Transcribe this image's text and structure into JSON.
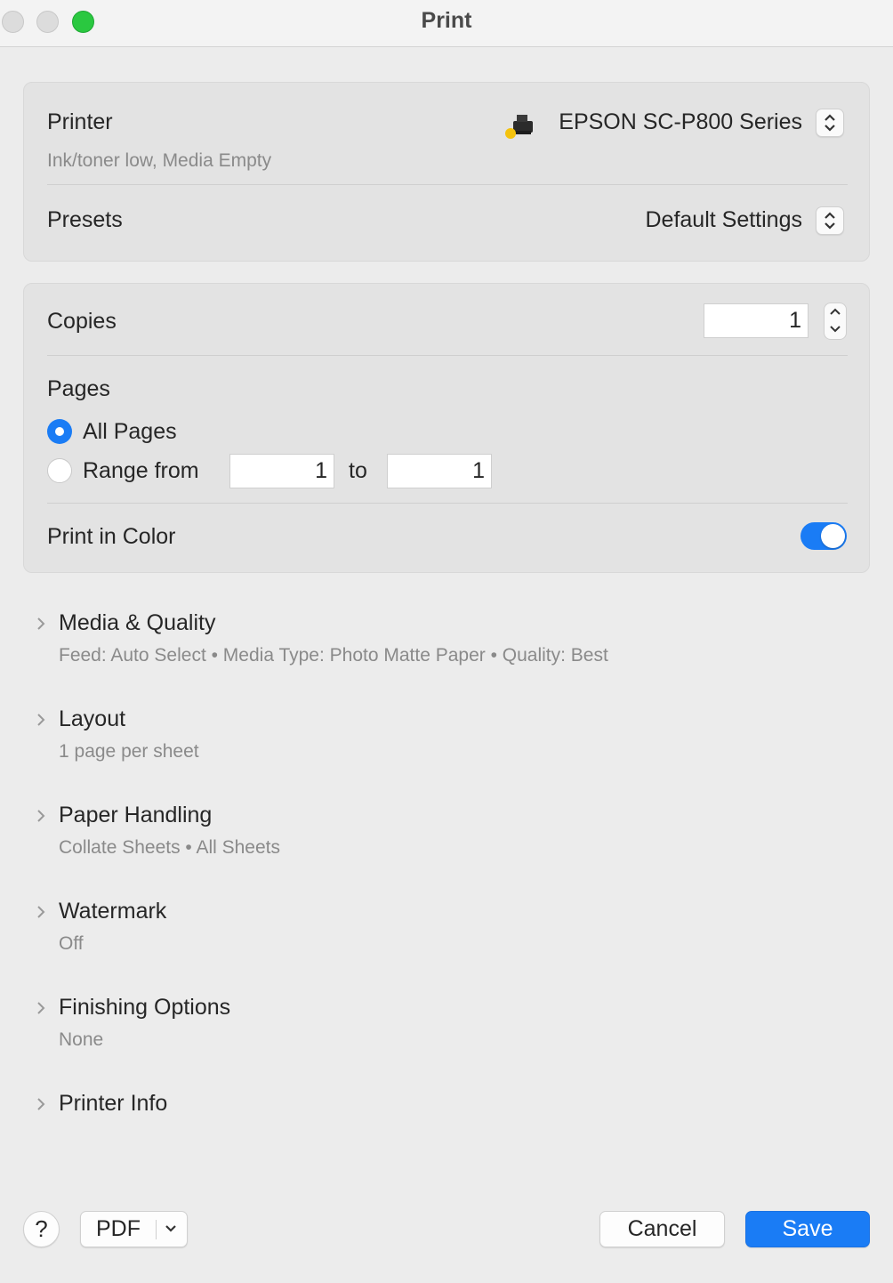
{
  "window": {
    "title": "Print"
  },
  "printer_group": {
    "printer_label": "Printer",
    "printer_value": "EPSON SC-P800 Series",
    "printer_status": "Ink/toner low, Media Empty",
    "presets_label": "Presets",
    "presets_value": "Default Settings"
  },
  "options_group": {
    "copies_label": "Copies",
    "copies_value": "1",
    "pages_label": "Pages",
    "all_pages_label": "All Pages",
    "all_pages_selected": true,
    "range_from_label": "Range from",
    "range_from_value": "1",
    "range_to_label": "to",
    "range_to_value": "1",
    "print_in_color_label": "Print in Color",
    "print_in_color_on": true
  },
  "sections": [
    {
      "title": "Media & Quality",
      "desc": "Feed: Auto Select • Media Type: Photo Matte Paper • Quality: Best"
    },
    {
      "title": "Layout",
      "desc": "1 page per sheet"
    },
    {
      "title": "Paper Handling",
      "desc": "Collate Sheets • All Sheets"
    },
    {
      "title": "Watermark",
      "desc": "Off"
    },
    {
      "title": "Finishing Options",
      "desc": "None"
    },
    {
      "title": "Printer Info",
      "desc": ""
    }
  ],
  "footer": {
    "help_label": "?",
    "pdf_label": "PDF",
    "cancel_label": "Cancel",
    "save_label": "Save"
  },
  "colors": {
    "accent": "#1a7cf5",
    "zoom_button": "#2ac840",
    "background": "#ececec"
  }
}
